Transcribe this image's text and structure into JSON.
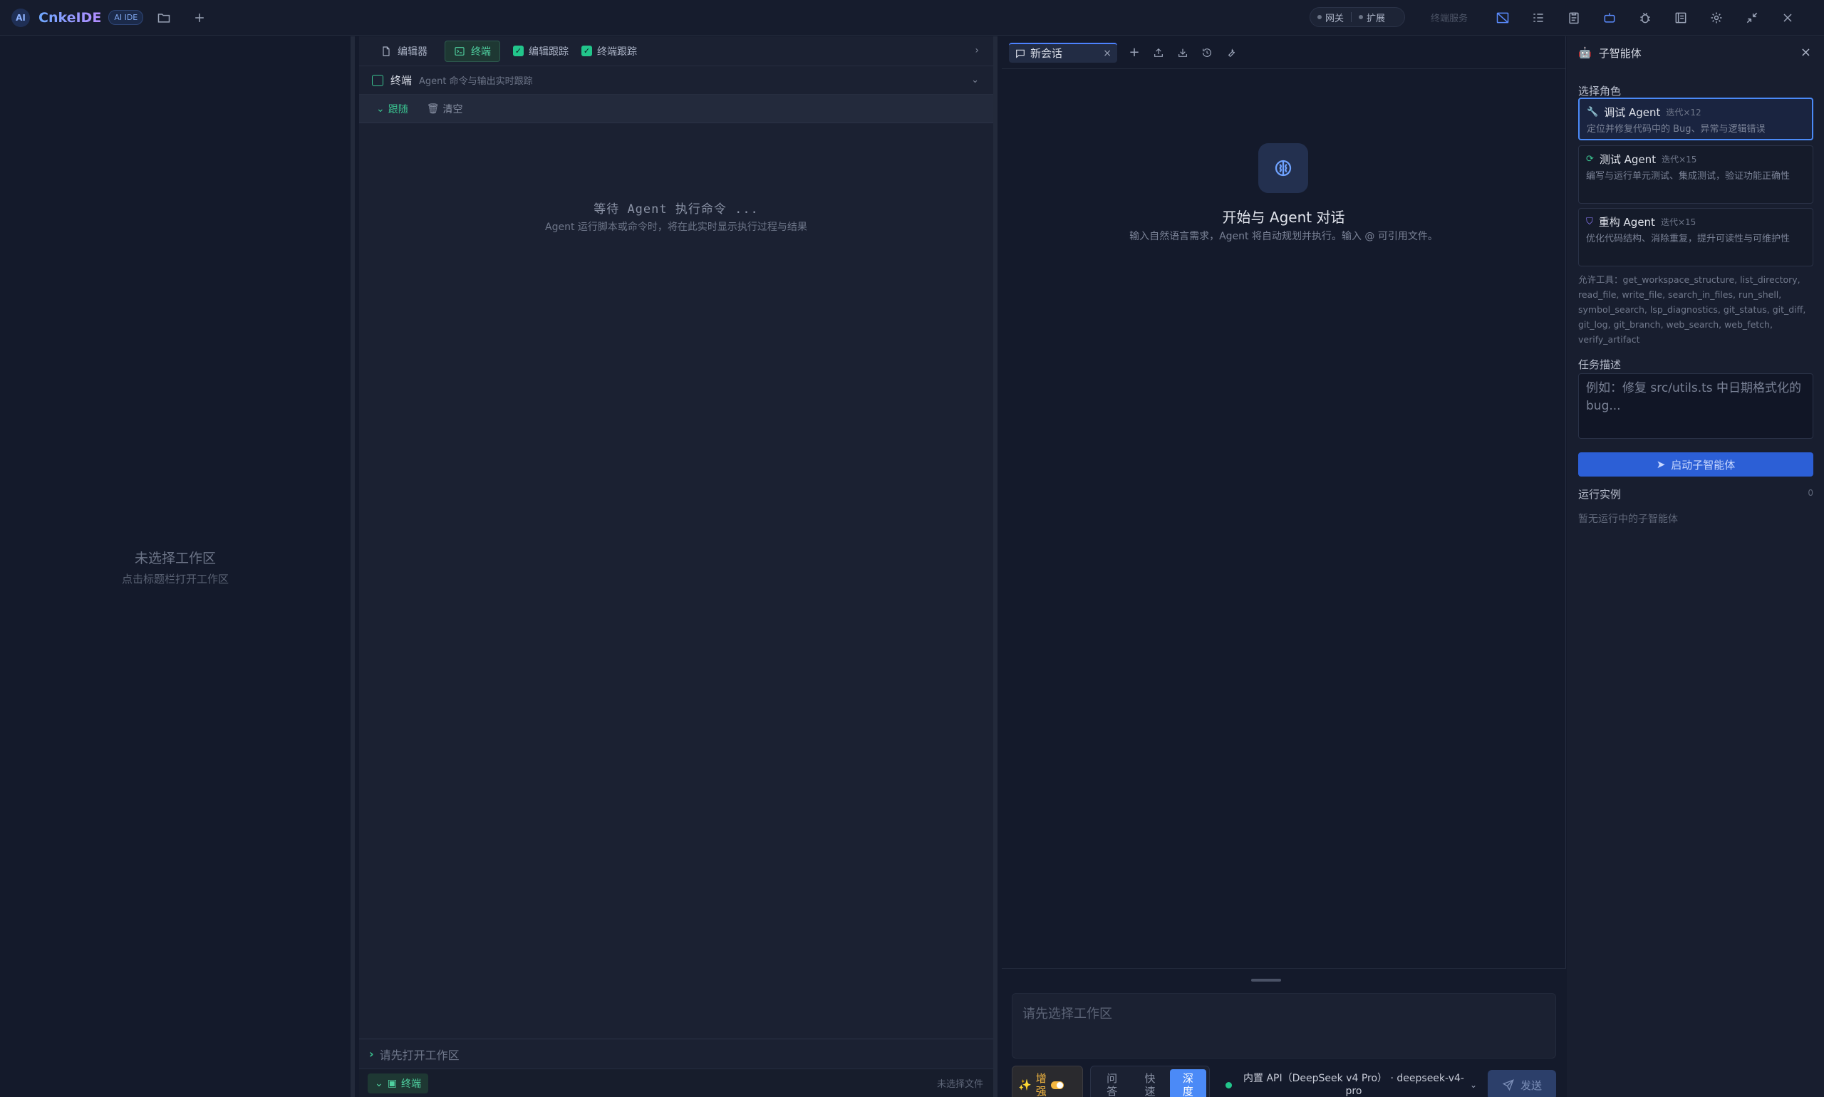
{
  "app": {
    "logo_text": "AI",
    "name": "CnkeIDE",
    "badge": "AI IDE"
  },
  "titlebar": {
    "gateway_label": "网关",
    "extensions_label": "扩展",
    "disabled_button": "终端服务"
  },
  "workspace": {
    "empty_title": "未选择工作区",
    "empty_hint": "点击标题栏打开工作区"
  },
  "terminal": {
    "tab_editor": "编辑器",
    "tab_terminal": "终端",
    "check_editor_follow": "编辑跟踪",
    "check_terminal_follow": "终端跟踪",
    "header_title": "终端",
    "header_subtitle": "Agent 命令与输出实时跟踪",
    "action_follow": "跟随",
    "action_clear": "清空",
    "waiting_title": "等待 Agent 执行命令 ...",
    "waiting_subtitle": "Agent 运行脚本或命令时，将在此实时显示执行过程与结果",
    "prompt_text": "请先打开工作区",
    "status_tab": "终端",
    "status_file": "未选择文件"
  },
  "chat": {
    "tab_label": "新会话",
    "welcome_title": "开始与 Agent 对话",
    "welcome_subtitle": "输入自然语言需求，Agent 将自动规划并执行。输入 @ 可引用文件。",
    "input_placeholder": "请先选择工作区",
    "enhance_line1": "增",
    "enhance_line2": "强",
    "modes": [
      {
        "l1": "问",
        "l2": "答"
      },
      {
        "l1": "快",
        "l2": "速"
      },
      {
        "l1": "深",
        "l2": "度"
      }
    ],
    "active_mode_index": 2,
    "model_line1": "内置 API（DeepSeek v4 Pro） · deepseek-v4-",
    "model_line2": "pro",
    "send_label": "发送",
    "model_status_color": "#22c58b"
  },
  "subagent": {
    "panel_title": "子智能体",
    "select_role_label": "选择角色",
    "roles": [
      {
        "name": "调试 Agent",
        "iter": "迭代×12",
        "desc": "定位并修复代码中的 Bug、异常与逻辑错误",
        "icon": "wrench-icon"
      },
      {
        "name": "测试 Agent",
        "iter": "迭代×15",
        "desc": "编写与运行单元测试、集成测试，验证功能正确性",
        "icon": "refresh-icon"
      },
      {
        "name": "重构 Agent",
        "iter": "迭代×15",
        "desc": "优化代码结构、消除重复，提升可读性与可维护性",
        "icon": "shield-icon"
      }
    ],
    "active_role_index": 0,
    "tools_text": "允许工具：get_workspace_structure, list_directory, read_file, write_file, search_in_files, run_shell, symbol_search, lsp_diagnostics, git_status, git_diff, git_log, git_branch, web_search, web_fetch, verify_artifact",
    "task_label": "任务描述",
    "task_placeholder": "例如：修复 src/utils.ts 中日期格式化的 bug...",
    "launch_label": "启动子智能体",
    "running_label": "运行实例",
    "running_count": "0",
    "no_running": "暂无运行中的子智能体"
  },
  "colors": {
    "accent_blue": "#4b8af7",
    "accent_green": "#3ac28f",
    "accent_amber": "#f4b740"
  }
}
